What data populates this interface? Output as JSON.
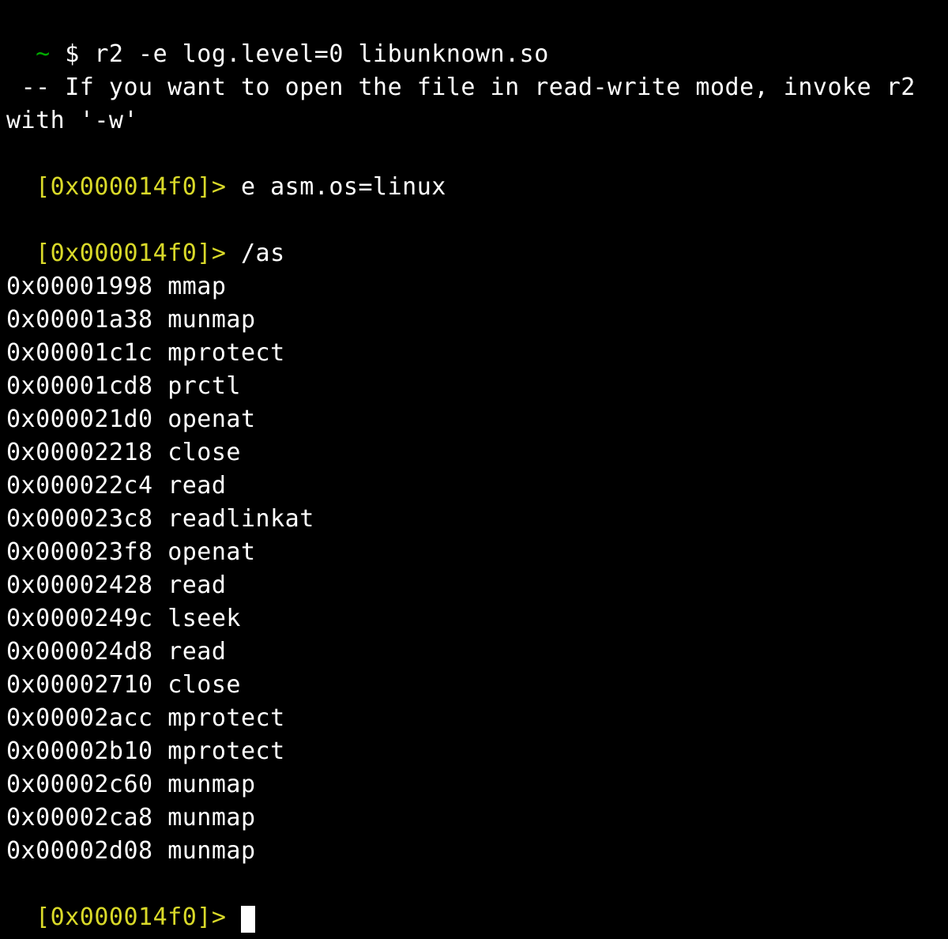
{
  "shell": {
    "tilde": "~",
    "dollar": " $ ",
    "command": "r2 -e log.level=0 libunknown.so"
  },
  "motd": " -- If you want to open the file in read-write mode, invoke r2 with '-w'",
  "prompts": {
    "p1": "[0x000014f0]>",
    "p2": "[0x000014f0]>",
    "p3": "[0x000014f0]>"
  },
  "commands": {
    "c1": " e asm.os=linux",
    "c2": " /as"
  },
  "syscalls": [
    {
      "addr": "0x00001998",
      "name": "mmap"
    },
    {
      "addr": "0x00001a38",
      "name": "munmap"
    },
    {
      "addr": "0x00001c1c",
      "name": "mprotect"
    },
    {
      "addr": "0x00001cd8",
      "name": "prctl"
    },
    {
      "addr": "0x000021d0",
      "name": "openat"
    },
    {
      "addr": "0x00002218",
      "name": "close"
    },
    {
      "addr": "0x000022c4",
      "name": "read"
    },
    {
      "addr": "0x000023c8",
      "name": "readlinkat"
    },
    {
      "addr": "0x000023f8",
      "name": "openat"
    },
    {
      "addr": "0x00002428",
      "name": "read"
    },
    {
      "addr": "0x0000249c",
      "name": "lseek"
    },
    {
      "addr": "0x000024d8",
      "name": "read"
    },
    {
      "addr": "0x00002710",
      "name": "close"
    },
    {
      "addr": "0x00002acc",
      "name": "mprotect"
    },
    {
      "addr": "0x00002b10",
      "name": "mprotect"
    },
    {
      "addr": "0x00002c60",
      "name": "munmap"
    },
    {
      "addr": "0x00002ca8",
      "name": "munmap"
    },
    {
      "addr": "0x00002d08",
      "name": "munmap"
    }
  ]
}
